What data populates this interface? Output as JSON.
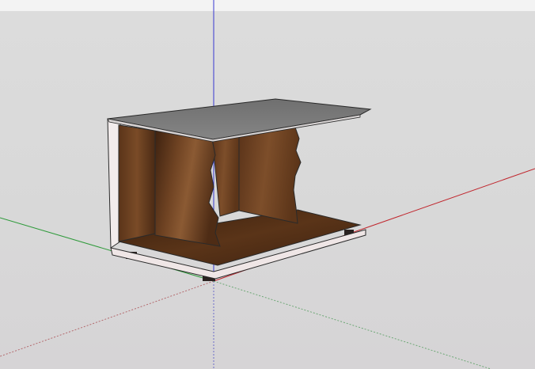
{
  "app": {
    "title": "",
    "mode": "3d-modeling-viewport"
  },
  "viewport": {
    "background_color": "#d9d9d9",
    "axes": {
      "red_axis_color": "#c0262d",
      "green_axis_color": "#2e9a3a",
      "blue_axis_color": "#3838d0"
    }
  },
  "model": {
    "name": "",
    "top_surface_color": "#7a7a7a",
    "edge_color": "#ece8e8",
    "wood_colors": [
      "#4a2a14",
      "#6b3f20",
      "#8a5a34",
      "#5a3419"
    ],
    "foot_color": "#2a2220"
  }
}
